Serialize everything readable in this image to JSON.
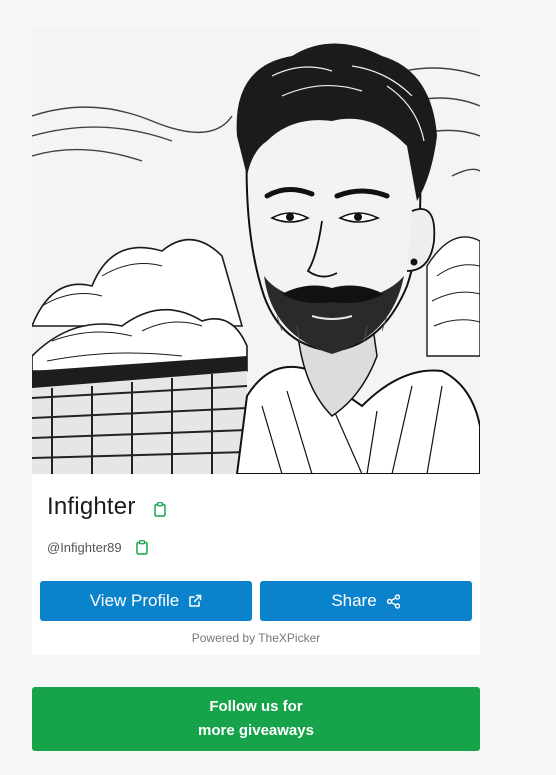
{
  "profile": {
    "name": "Infighter",
    "handle": "@Infighter89"
  },
  "actions": {
    "view_profile_label": "View Profile",
    "share_label": "Share"
  },
  "footer": {
    "powered_by": "Powered by TheXPicker"
  },
  "promo": {
    "line1": "Follow us for",
    "line2": "more giveaways"
  },
  "icons": {
    "copy": "clipboard-icon",
    "external": "external-link-icon",
    "share": "share-icon"
  },
  "colors": {
    "primary_button": "#0a83cc",
    "promo_button": "#17a34a",
    "copy_icon": "#17a34a"
  }
}
